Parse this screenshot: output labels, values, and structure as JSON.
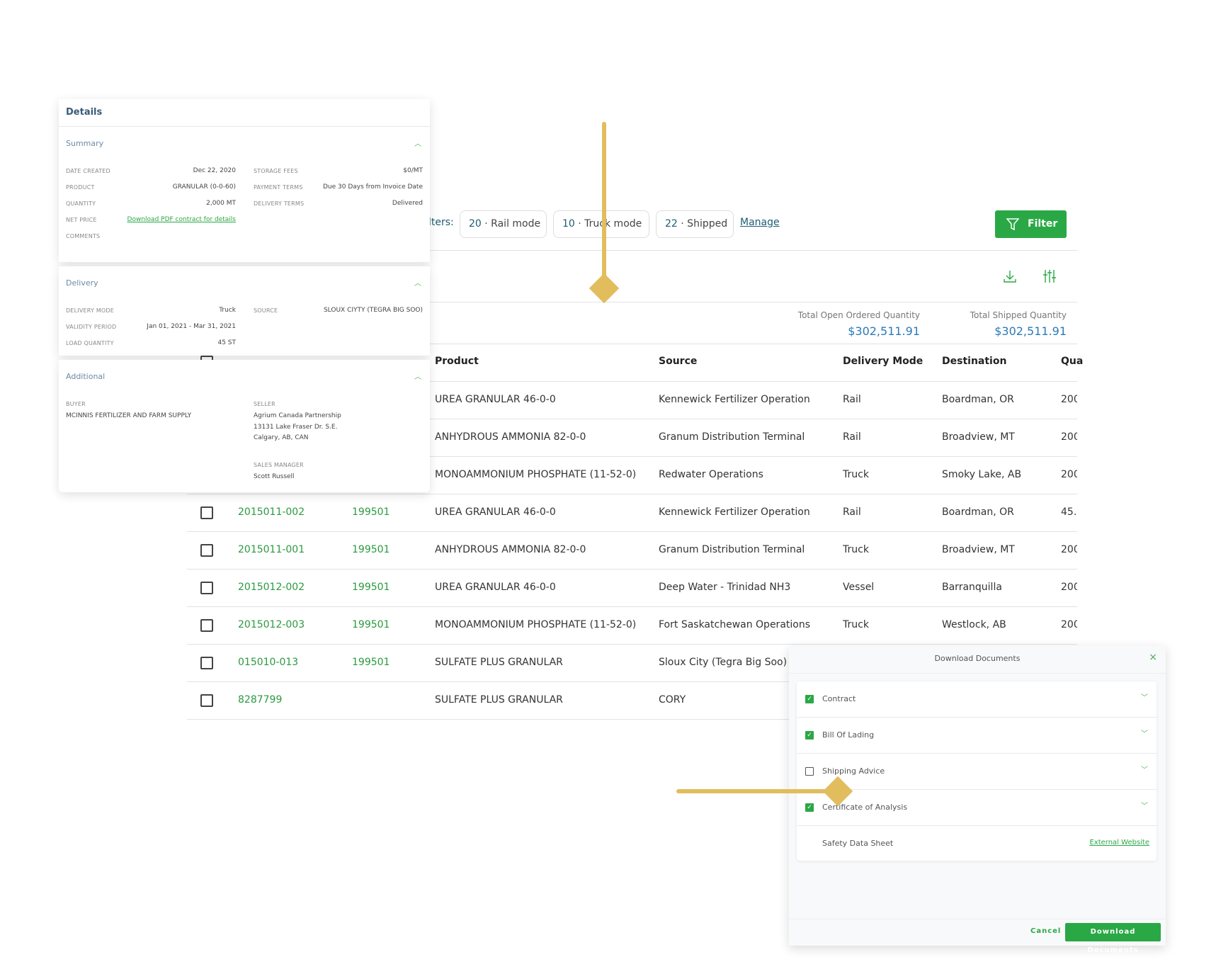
{
  "filters": {
    "label": "lters:",
    "chips": [
      {
        "count": "20",
        "label": "· Rail mode"
      },
      {
        "count": "10",
        "label": "· Truck mode"
      },
      {
        "count": "22",
        "label": "· Shipped"
      }
    ],
    "manage": "Manage",
    "filter_button": "Filter"
  },
  "totals": {
    "open_label": "Total Open Ordered Quantity",
    "open_value": "$302,511.91",
    "shipped_label": "Total Shipped Quantity",
    "shipped_value": "$302,511.91"
  },
  "table": {
    "headers": {
      "product": "Product",
      "source": "Source",
      "delivery_mode": "Delivery Mode",
      "destination": "Destination",
      "quantity": "Qua"
    },
    "rows": [
      {
        "order": "",
        "contract": "",
        "product": "UREA GRANULAR 46-0-0",
        "source": "Kennewick Fertilizer Operation",
        "mode": "Rail",
        "destination": "Boardman, OR",
        "qty": "200"
      },
      {
        "order": "",
        "contract": "",
        "product": "ANHYDROUS AMMONIA 82-0-0",
        "source": "Granum Distribution Terminal",
        "mode": "Rail",
        "destination": "Broadview, MT",
        "qty": "200"
      },
      {
        "order": "",
        "contract": "",
        "product": "MONOAMMONIUM PHOSPHATE (11-52-0)",
        "source": "Redwater Operations",
        "mode": "Truck",
        "destination": "Smoky Lake, AB",
        "qty": "200"
      },
      {
        "order": "2015011-002",
        "contract": "199501",
        "product": "UREA GRANULAR 46-0-0",
        "source": "Kennewick Fertilizer Operation",
        "mode": "Rail",
        "destination": "Boardman, OR",
        "qty": "45.:"
      },
      {
        "order": "2015011-001",
        "contract": "199501",
        "product": "ANHYDROUS AMMONIA 82-0-0",
        "source": "Granum Distribution Terminal",
        "mode": "Truck",
        "destination": "Broadview, MT",
        "qty": "200"
      },
      {
        "order": "2015012-002",
        "contract": "199501",
        "product": "UREA GRANULAR 46-0-0",
        "source": "Deep Water - Trinidad NH3",
        "mode": "Vessel",
        "destination": "Barranquilla",
        "qty": "200"
      },
      {
        "order": "2015012-003",
        "contract": "199501",
        "product": "MONOAMMONIUM PHOSPHATE (11-52-0)",
        "source": "Fort Saskatchewan Operations",
        "mode": "Truck",
        "destination": "Westlock, AB",
        "qty": "200"
      },
      {
        "order": "015010-013",
        "contract": "199501",
        "product": "SULFATE PLUS GRANULAR",
        "source": "Sloux City (Tegra Big Soo)",
        "mode": "",
        "destination": "",
        "qty": ""
      },
      {
        "order": "8287799",
        "contract": "",
        "product": "SULFATE PLUS GRANULAR",
        "source": "CORY",
        "mode": "",
        "destination": "",
        "qty": ""
      }
    ]
  },
  "details": {
    "title": "Details",
    "summary": {
      "title": "Summary",
      "date_created_label": "DATE CREATED",
      "date_created": "Dec 22, 2020",
      "product_label": "PRODUCT",
      "product": "GRANULAR (0-0-60)",
      "quantity_label": "QUANTITY",
      "quantity": "2,000 MT",
      "net_price_label": "NET PRICE",
      "net_price_link": "Download PDF contract for details",
      "comments_label": "COMMENTS",
      "storage_label": "STORAGE FEES",
      "storage": "$0/MT",
      "payment_label": "PAYMENT TERMS",
      "payment": "Due 30 Days from Invoice Date",
      "delivery_terms_label": "DELIVERY TERMS",
      "delivery_terms": "Delivered"
    },
    "delivery": {
      "title": "Delivery",
      "mode_label": "DELIVERY MODE",
      "mode": "Truck",
      "validity_label": "VALIDITY PERIOD",
      "validity": "Jan 01, 2021 - Mar 31, 2021",
      "load_label": "LOAD QUANTITY",
      "load": "45 ST",
      "source_label": "SOURCE",
      "source": "SLOUX CIYTY (TEGRA BIG SOO)"
    },
    "additional": {
      "title": "Additional",
      "buyer_label": "BUYER",
      "buyer": "MCINNIS FERTILIZER AND FARM SUPPLY",
      "seller_label": "SELLER",
      "seller_1": "Agrium Canada Partnership",
      "seller_2": "13131 Lake Fraser Dr. S.E.",
      "seller_3": "Calgary, AB, CAN",
      "manager_label": "SALES MANAGER",
      "manager": "Scott Russell"
    }
  },
  "download": {
    "title": "Download Documents",
    "items": [
      {
        "label": "Contract",
        "checked": true
      },
      {
        "label": "Bill Of Lading",
        "checked": true
      },
      {
        "label": "Shipping Advice",
        "checked": false
      },
      {
        "label": "Certificate of Analysis",
        "checked": true
      }
    ],
    "sds_label": "Safety Data Sheet",
    "sds_link": "External Website",
    "cancel": "Cancel",
    "submit": "Download Documents"
  },
  "colors": {
    "green": "#2aa845",
    "blue": "#2a7ab8",
    "annotation": "#e2bd5e"
  }
}
